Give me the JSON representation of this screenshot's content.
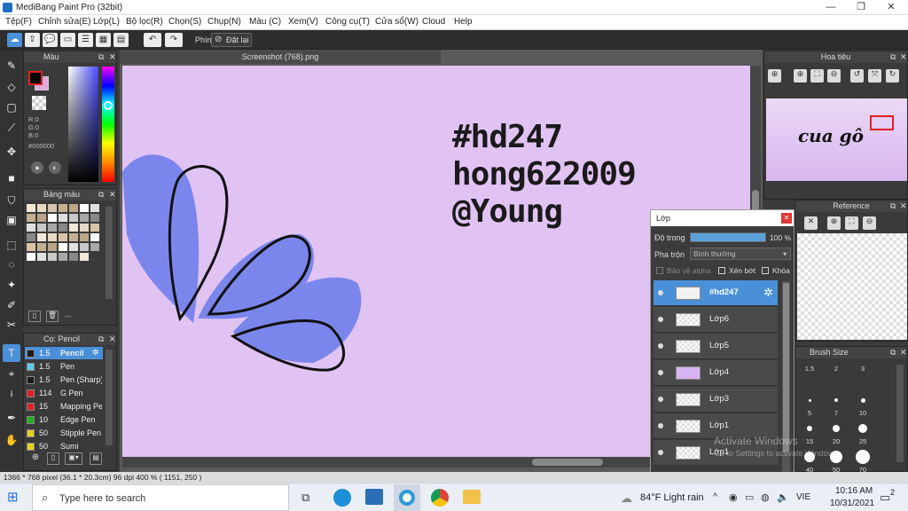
{
  "window": {
    "title": "MediBang Paint Pro (32bit)",
    "min": "—",
    "restore": "❐",
    "close": "✕"
  },
  "menu": [
    "Tệp(F)",
    "Chỉnh sửa(E)",
    "Lớp(L)",
    "Bộ lọc(R)",
    "Chọn(S)",
    "Chụp(N)",
    "Màu (C)",
    "Xem(V)",
    "Công cụ(T)",
    "Cửa sổ(W)",
    "Cloud",
    "Help"
  ],
  "toolbar": {
    "shortcut_label": "Phím",
    "reset_label": "Đặt lại"
  },
  "color_panel": {
    "title": "Màu",
    "r": "R:0",
    "g": "G:0",
    "b": "B:0",
    "hex": "#000000"
  },
  "palette_panel": {
    "title": "Bảng màu",
    "status": "---"
  },
  "brush_panel": {
    "title": "Cọ: Pencil",
    "items": [
      {
        "size": "1.5",
        "name": "Pencil",
        "color": "#1c1c1c",
        "selected": true
      },
      {
        "size": "1.5",
        "name": "Pen",
        "color": "#5cc8f0"
      },
      {
        "size": "1.5",
        "name": "Pen (Sharp)",
        "color": "#1c1c1c"
      },
      {
        "size": "114",
        "name": "G Pen",
        "color": "#e02020"
      },
      {
        "size": "15",
        "name": "Mapping Pen",
        "color": "#e02020"
      },
      {
        "size": "10",
        "name": "Edge Pen",
        "color": "#22b022"
      },
      {
        "size": "50",
        "name": "Stipple Pen",
        "color": "#e8d020"
      },
      {
        "size": "50",
        "name": "Sumi",
        "color": "#e8d020"
      }
    ]
  },
  "document": {
    "tab": "Screenshot (768).png",
    "line1": "#hd247",
    "line2": "hong622009",
    "line3": "@Young"
  },
  "navigator": {
    "title": "Hoa tiêu",
    "preview_text": "cua gô"
  },
  "reference": {
    "title": "Reference"
  },
  "brush_size": {
    "title": "Brush Size",
    "labels": [
      "1.5",
      "2",
      "3",
      "5",
      "7",
      "10",
      "15",
      "20",
      "25",
      "40",
      "50",
      "70"
    ]
  },
  "layers": {
    "title": "Lớp",
    "opacity_label": "Độ trong",
    "opacity_value": "100 %",
    "opacity": 1.0,
    "blend_label": "Pha trộn",
    "blend_value": "Bình thường",
    "protect_alpha": "Bảo vệ alpha",
    "clipping": "Xén bớt",
    "lock": "Khóa",
    "items": [
      {
        "name": "#hd247",
        "selected": true
      },
      {
        "name": "Lớp6"
      },
      {
        "name": "Lớp5"
      },
      {
        "name": "Lớp4"
      },
      {
        "name": "Lớp3"
      },
      {
        "name": "Lớp1"
      },
      {
        "name": "Lớp1"
      }
    ]
  },
  "status": "1366 * 768 pixel   (36.1 * 20.3cm)   96 dpi   400 %   ( 1151, 250 )",
  "watermark": {
    "line1": "Activate Windows",
    "line2": "Go to Settings to activate Windows."
  },
  "taskbar": {
    "search_placeholder": "Type here to search",
    "weather": "84°F  Light rain",
    "lang": "VIE",
    "time": "10:16 AM",
    "date": "10/31/2021",
    "notif": "2"
  },
  "colors": {
    "canvas": "#e1c3f3",
    "petal": "#7b86ec",
    "accent": "#4a90d9"
  }
}
